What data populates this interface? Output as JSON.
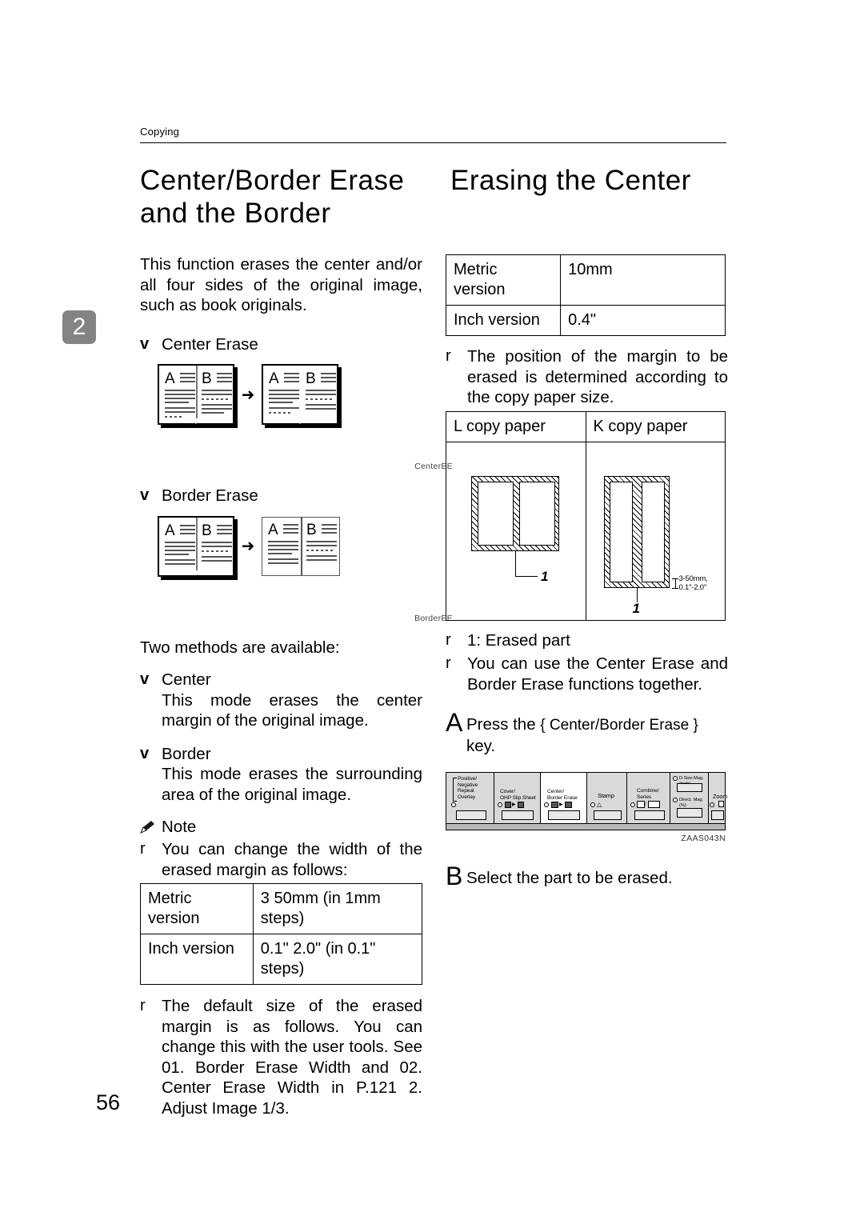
{
  "running_header": "Copying",
  "chapter_tab": "2",
  "page_number": "56",
  "left": {
    "title": "Center/Border Erase and the Border",
    "intro": "This function erases the center and/or all four sides of the original image, such as book originals.",
    "bullet_center_erase": "Center Erase",
    "fig_center_caption": "CenterEE",
    "bullet_border_erase": "Border Erase",
    "fig_border_caption": "BorderEE",
    "two_methods": "Two methods are available:",
    "center_heading": "Center",
    "center_text": "This mode erases the center margin of the original image.",
    "border_heading": "Border",
    "border_text": "This mode erases the surrounding area of the original image.",
    "note_label": "Note",
    "note_width": "You can change the width of the erased margin as follows:",
    "table_width": {
      "rows": [
        {
          "label": "Metric version",
          "value": "3  50mm (in 1mm steps)"
        },
        {
          "label": "Inch version",
          "value": "0.1\"  2.0\" (in 0.1\" steps)"
        }
      ]
    },
    "note_default": "The default size of the erased margin is as follows. You can change this with the user tools. See  01. Border Erase Width  and  02. Center Erase Width  in    P.121 2. Adjust Image 1/3."
  },
  "right": {
    "title": "Erasing the Center",
    "table_default": {
      "rows": [
        {
          "label": "Metric version",
          "value": "10mm"
        },
        {
          "label": "Inch version",
          "value": "0.4\""
        }
      ]
    },
    "note_position": "The position of the margin to be erased is determined according to the copy paper size.",
    "diagram_table": {
      "headers": [
        "L  copy paper",
        "K  copy paper"
      ],
      "callout_left": "1",
      "callout_right": "1",
      "dimension_line1": "3-50mm,",
      "dimension_line2": "0.1\"-2.0\""
    },
    "note_erased_part": "1: Erased part",
    "note_together": "You can use the Center Erase and Border Erase functions together.",
    "step_a_num": "A",
    "step_a_text_before": "Press  the  ",
    "step_a_key": "{ Center/Border  Erase }",
    "step_a_text_after": " key.",
    "step_b_num": "B",
    "step_b_text": "Select the part to be erased.",
    "panel_figure_id": "ZAAS043N",
    "panel": {
      "cells": [
        {
          "labels": [
            "Positive/",
            "Negative",
            "Repeat",
            "Overlay"
          ]
        },
        {
          "labels": [
            "Cover/",
            "OHP Slip Sheet"
          ]
        },
        {
          "labels": [
            "Center/",
            "Border Erase"
          ]
        },
        {
          "labels": [
            "Stamp"
          ]
        },
        {
          "labels": [
            "Combine/",
            "Series"
          ]
        },
        {
          "labels": [
            "D.Size Mag.(inch)",
            "Direct. Mag.(%)"
          ]
        },
        {
          "labels": [
            "Zoom"
          ]
        }
      ]
    }
  }
}
